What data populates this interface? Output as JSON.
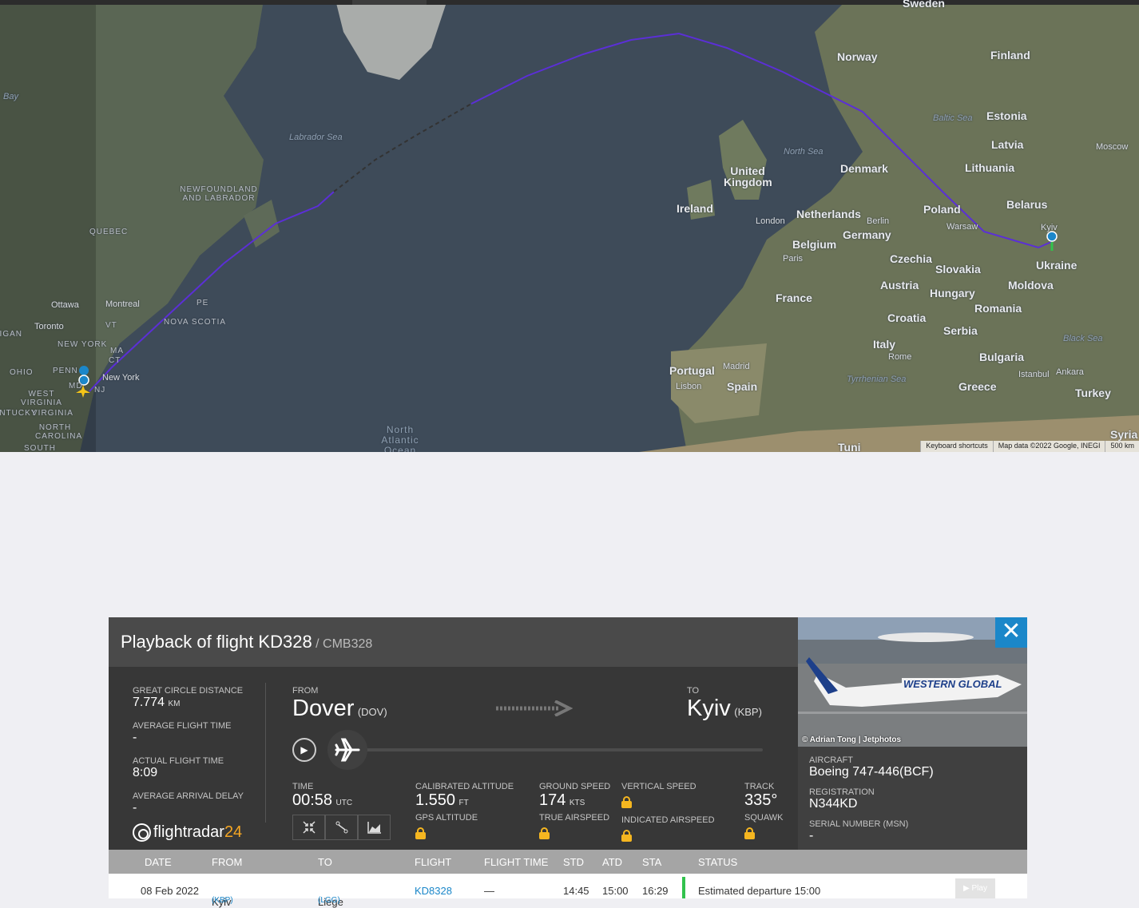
{
  "map": {
    "labels_countries": [
      "Norway",
      "Finland",
      "Estonia",
      "Latvia",
      "Lithuania",
      "Belarus",
      "Poland",
      "Ukraine",
      "Moldova",
      "Romania",
      "Denmark",
      "United Kingdom",
      "Ireland",
      "Netherlands",
      "Germany",
      "Belgium",
      "Czechia",
      "Slovakia",
      "Austria",
      "Hungary",
      "France",
      "Croatia",
      "Serbia",
      "Bulgaria",
      "Italy",
      "Greece",
      "Turkey",
      "Portugal",
      "Spain",
      "Sweden",
      "Syria",
      "Tuni"
    ],
    "labels_cities": [
      "London",
      "Paris",
      "Berlin",
      "Warsaw",
      "Kyiv",
      "Moscow",
      "Madrid",
      "Lisbon",
      "Rome",
      "Istanbul",
      "Ankara",
      "Ottawa",
      "Montreal",
      "Toronto",
      "New York"
    ],
    "labels_regions": [
      "NEWFOUNDLAND AND LABRADOR",
      "QUEBEC",
      "PE",
      "NOVA SCOTIA",
      "NEW YORK",
      "VT",
      "MA",
      "CT",
      "PENN",
      "OHIO",
      "WEST VIRGINIA",
      "VIRGINIA",
      "NORTH CAROLINA",
      "NJ",
      "MD",
      "KENTUCKY",
      "SOUTH",
      "MICHIGAN"
    ],
    "labels_seas": [
      "Labrador Sea",
      "North Sea",
      "Baltic Sea",
      "Black Sea",
      "Tyrrhenian Sea",
      "Bay",
      "North Atlantic Ocean"
    ],
    "footer": {
      "shortcuts": "Keyboard shortcuts",
      "attribution": "Map data ©2022 Google, INEGI",
      "scale": "500 km"
    },
    "route_color": "#5b2fd6"
  },
  "panel": {
    "title": "Playback of flight KD328",
    "subtitle": "/ CMB328",
    "close_icon": "close-icon",
    "photo_credit": "© Adrian Tong | Jetphotos",
    "stats": {
      "great_circle_label": "GREAT CIRCLE DISTANCE",
      "great_circle_value": "7.774",
      "great_circle_unit": "KM",
      "avg_flight_time_label": "AVERAGE FLIGHT TIME",
      "avg_flight_time_value": "-",
      "actual_flight_time_label": "ACTUAL FLIGHT TIME",
      "actual_flight_time_value": "8:09",
      "avg_arrival_delay_label": "AVERAGE ARRIVAL DELAY",
      "avg_arrival_delay_value": "-"
    },
    "logo": {
      "brand": "flightradar",
      "suffix": "24"
    },
    "route": {
      "from_label": "FROM",
      "from_city": "Dover",
      "from_code": "(DOV)",
      "to_label": "TO",
      "to_city": "Kyiv",
      "to_code": "(KBP)"
    },
    "metrics": {
      "time_label": "TIME",
      "time_value": "00:58",
      "time_unit": "UTC",
      "cal_alt_label": "CALIBRATED ALTITUDE",
      "cal_alt_value": "1.550",
      "cal_alt_unit": "FT",
      "gps_alt_label": "GPS ALTITUDE",
      "ground_speed_label": "GROUND SPEED",
      "ground_speed_value": "174",
      "ground_speed_unit": "KTS",
      "true_airspeed_label": "TRUE AIRSPEED",
      "vertical_speed_label": "VERTICAL SPEED",
      "indicated_airspeed_label": "INDICATED AIRSPEED",
      "track_label": "TRACK",
      "track_value": "335°",
      "squawk_label": "SQUAWK"
    },
    "playback_progress": 0.0,
    "aircraft": {
      "aircraft_label": "AIRCRAFT",
      "aircraft_value": "Boeing 747-446(BCF)",
      "registration_label": "REGISTRATION",
      "registration_value": "N344KD",
      "serial_label": "SERIAL NUMBER (MSN)",
      "serial_value": "-"
    }
  },
  "table": {
    "headers": [
      "DATE",
      "FROM",
      "TO",
      "FLIGHT",
      "FLIGHT TIME",
      "STD",
      "ATD",
      "STA",
      "STATUS"
    ],
    "rows": [
      {
        "date": "08 Feb 2022",
        "from": "Kyiv",
        "from_code": "(KBP)",
        "to": "Liege",
        "to_code": "(LGG)",
        "flight": "KD8328",
        "flight_time": "—",
        "std": "14:45",
        "atd": "15:00",
        "sta": "16:29",
        "status": "Estimated departure 15:00",
        "play_label": "▶ Play"
      }
    ]
  }
}
